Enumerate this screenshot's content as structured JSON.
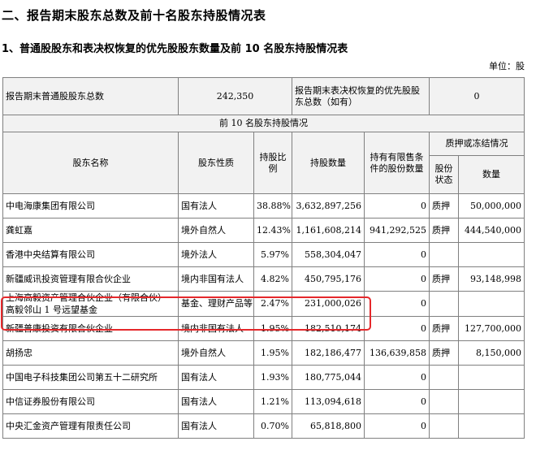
{
  "headings": {
    "section": "二、报告期末股东总数及前十名股东持股情况表",
    "sub": "1、普通股股东和表决权恢复的优先股股东数量及前 10 名股东持股情况表",
    "unit": "单位：股"
  },
  "summary": {
    "common_label": "报告期末普通股股东总数",
    "common_value": "242,350",
    "pref_label": "报告期末表决权恢复的优先股股东总数（如有）",
    "pref_value": "0"
  },
  "table_title": "前 10 名股东持股情况",
  "columns": {
    "name": "股东名称",
    "nature": "股东性质",
    "ratio": "持股比例",
    "qty": "持股数量",
    "restricted": "持有有限售条件的股份数量",
    "pledge_group": "质押或冻结情况",
    "pledge_status": "股份状态",
    "pledge_qty": "数量"
  },
  "rows": [
    {
      "name": "中电海康集团有限公司",
      "nature": "国有法人",
      "ratio": "38.88%",
      "qty": "3,632,897,256",
      "restricted": "0",
      "status": "质押",
      "pledged": "50,000,000"
    },
    {
      "name": "龚虹嘉",
      "nature": "境外自然人",
      "ratio": "12.43%",
      "qty": "1,161,608,214",
      "restricted": "941,292,525",
      "status": "质押",
      "pledged": "444,540,000"
    },
    {
      "name": "香港中央结算有限公司",
      "nature": "境外法人",
      "ratio": "5.97%",
      "qty": "558,304,047",
      "restricted": "0",
      "status": "",
      "pledged": ""
    },
    {
      "name": "新疆威讯投资管理有限合伙企业",
      "nature": "境内非国有法人",
      "ratio": "4.82%",
      "qty": "450,795,176",
      "restricted": "0",
      "status": "质押",
      "pledged": "93,148,998"
    },
    {
      "name": "上海高毅资产管理合伙企业（有限合伙）－高毅邻山 1 号远望基金",
      "nature": "基金、理财产品等",
      "ratio": "2.47%",
      "qty": "231,000,026",
      "restricted": "0",
      "status": "",
      "pledged": ""
    },
    {
      "name": "新疆普康投资有限合伙企业",
      "nature": "境内非国有法人",
      "ratio": "1.95%",
      "qty": "182,510,174",
      "restricted": "0",
      "status": "质押",
      "pledged": "127,700,000"
    },
    {
      "name": "胡扬忠",
      "nature": "境外自然人",
      "ratio": "1.95%",
      "qty": "182,186,477",
      "restricted": "136,639,858",
      "status": "质押",
      "pledged": "8,150,000"
    },
    {
      "name": "中国电子科技集团公司第五十二研究所",
      "nature": "国有法人",
      "ratio": "1.93%",
      "qty": "180,775,044",
      "restricted": "0",
      "status": "",
      "pledged": ""
    },
    {
      "name": "中信证券股份有限公司",
      "nature": "国有法人",
      "ratio": "1.21%",
      "qty": "113,094,618",
      "restricted": "0",
      "status": "",
      "pledged": ""
    },
    {
      "name": "中央汇金资产管理有限责任公司",
      "nature": "国有法人",
      "ratio": "0.70%",
      "qty": "65,818,800",
      "restricted": "0",
      "status": "",
      "pledged": ""
    }
  ],
  "colors": {
    "highlight": "#e5282b",
    "header_bg": "#f2f2f2",
    "border": "#808080"
  }
}
